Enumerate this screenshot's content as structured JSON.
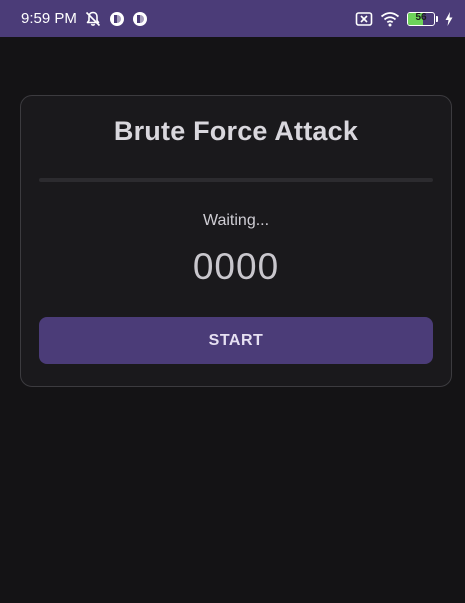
{
  "status_bar": {
    "time": "9:59 PM",
    "left_icons": [
      "notifications-off-icon",
      "app-indicator-icon",
      "app-indicator-icon"
    ],
    "right_icons": [
      "no-sim-icon",
      "wifi-icon",
      "battery-icon",
      "charging-icon"
    ],
    "battery_level": "56",
    "battery_fraction": 0.56,
    "background_color": "#4b3c78"
  },
  "card": {
    "title": "Brute Force Attack",
    "progress_fraction": 0.0,
    "status_text": "Waiting...",
    "pin_display": "0000",
    "start_button_label": "START",
    "button_color": "#4b3c78"
  }
}
